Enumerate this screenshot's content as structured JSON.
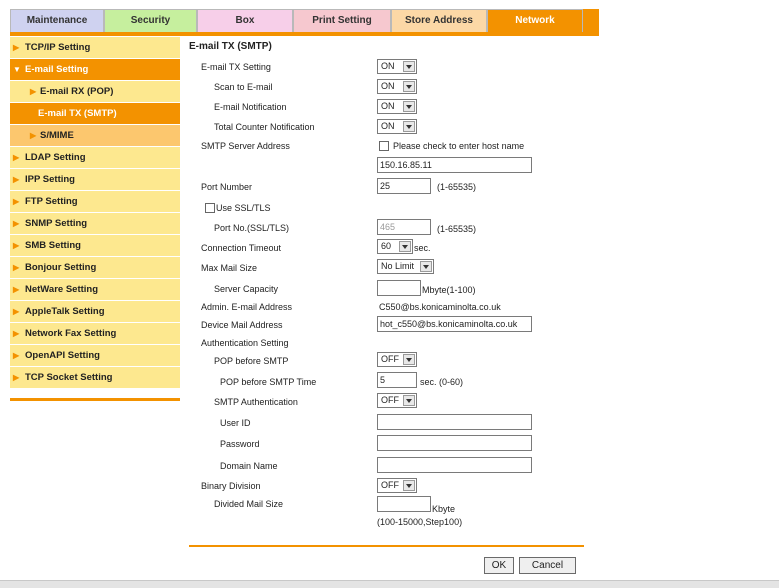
{
  "tabs": {
    "maintenance": "Maintenance",
    "security": "Security",
    "box": "Box",
    "print_setting": "Print Setting",
    "store_address": "Store Address",
    "network": "Network"
  },
  "sidebar": {
    "tcpip": "TCP/IP Setting",
    "email": "E-mail Setting",
    "email_rx": "E-mail RX (POP)",
    "email_tx": "E-mail TX (SMTP)",
    "smime": "S/MIME",
    "ldap": "LDAP Setting",
    "ipp": "IPP Setting",
    "ftp": "FTP Setting",
    "snmp": "SNMP Setting",
    "smb": "SMB Setting",
    "bonjour": "Bonjour Setting",
    "netware": "NetWare Setting",
    "appletalk": "AppleTalk Setting",
    "netfax": "Network Fax Setting",
    "openapi": "OpenAPI Setting",
    "tcpsocket": "TCP Socket Setting"
  },
  "form": {
    "title": "E-mail TX (SMTP)",
    "email_tx_setting": "E-mail TX Setting",
    "email_tx_value": "ON",
    "scan_to_email": "Scan to E-mail",
    "scan_to_email_value": "ON",
    "email_notification": "E-mail Notification",
    "email_notification_value": "ON",
    "total_counter": "Total Counter Notification",
    "total_counter_value": "ON",
    "smtp_server": "SMTP Server Address",
    "host_check": "Please check to enter host name",
    "smtp_server_value": "150.16.85.11",
    "port_number": "Port Number",
    "port_value": "25",
    "port_range": "(1-65535)",
    "use_ssl": "Use SSL/TLS",
    "port_ssl": "Port No.(SSL/TLS)",
    "port_ssl_value": "465",
    "port_ssl_range": "(1-65535)",
    "conn_timeout": "Connection Timeout",
    "conn_timeout_value": "60",
    "sec": "sec.",
    "max_mail": "Max Mail Size",
    "max_mail_value": "No Limit",
    "server_capacity": "Server Capacity",
    "server_capacity_unit": "Mbyte(1-100)",
    "admin_email": "Admin. E-mail Address",
    "admin_email_value": "C550@bs.konicaminolta.co.uk",
    "device_mail": "Device Mail Address",
    "device_mail_value": "hot_c550@bs.konicaminolta.co.uk",
    "auth_setting": "Authentication Setting",
    "pop_before_smtp": "POP before SMTP",
    "pop_before_smtp_value": "OFF",
    "pop_time": "POP before SMTP Time",
    "pop_time_value": "5",
    "pop_time_unit": "sec. (0-60)",
    "smtp_auth": "SMTP Authentication",
    "smtp_auth_value": "OFF",
    "user_id": "User ID",
    "password": "Password",
    "domain_name": "Domain Name",
    "binary_division": "Binary Division",
    "binary_division_value": "OFF",
    "divided_size": "Divided Mail Size",
    "divided_unit": "Kbyte",
    "divided_range": "(100-15000,Step100)"
  },
  "buttons": {
    "ok": "OK",
    "cancel": "Cancel"
  }
}
